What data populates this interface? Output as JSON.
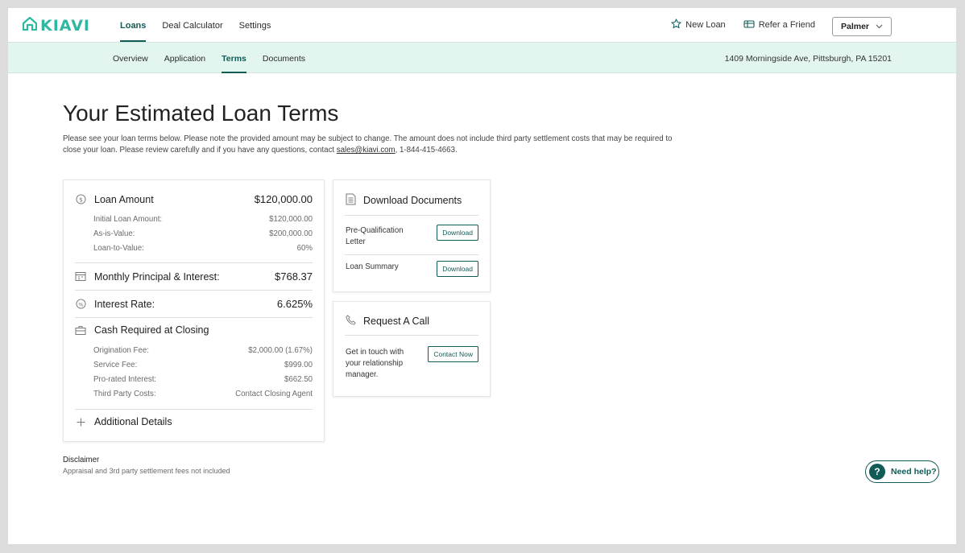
{
  "brand": {
    "name": "KIAVI",
    "color": "#2fb8a0",
    "accent": "#115b56"
  },
  "topnav": {
    "links": [
      {
        "label": "Loans",
        "active": true
      },
      {
        "label": "Deal Calculator",
        "active": false
      },
      {
        "label": "Settings",
        "active": false
      }
    ],
    "new_loan": "New Loan",
    "refer": "Refer a Friend",
    "user": "Palmer"
  },
  "subnav": {
    "links": [
      {
        "label": "Overview"
      },
      {
        "label": "Application"
      },
      {
        "label": "Terms"
      },
      {
        "label": "Documents"
      }
    ],
    "address": "1409 Morningside Ave, Pittsburgh, PA 15201"
  },
  "page": {
    "title": "Your Estimated Loan Terms",
    "intro_before": "Please see your loan terms below. Please note the provided amount may be subject to change. The amount does not include third party settlement costs that may be required to close your loan. Please review carefully and if you have any questions, contact ",
    "intro_email": "sales@kiavi.com",
    "intro_after": ", 1-844-415-4663."
  },
  "loan": {
    "amount_label": "Loan Amount",
    "amount_value": "$120,000.00",
    "amount_details": [
      {
        "label": "Initial Loan Amount:",
        "value": "$120,000.00"
      },
      {
        "label": "As-is-Value:",
        "value": "$200,000.00"
      },
      {
        "label": "Loan-to-Value:",
        "value": "60%"
      }
    ],
    "pi_label": "Monthly Principal & Interest:",
    "pi_value": "$768.37",
    "rate_label": "Interest Rate:",
    "rate_value": "6.625%",
    "cash_label": "Cash Required at Closing",
    "cash_details": [
      {
        "label": "Origination Fee:",
        "value": "$2,000.00 (1.67%)"
      },
      {
        "label": "Service Fee:",
        "value": "$999.00"
      },
      {
        "label": "Pro-rated Interest:",
        "value": "$662.50"
      },
      {
        "label": "Third Party Costs:",
        "value": "Contact Closing Agent"
      }
    ],
    "additional_label": "Additional Details"
  },
  "documents": {
    "title": "Download Documents",
    "items": [
      {
        "label_line1": "Pre-Qualification",
        "label_line2": "Letter",
        "button": "Download"
      },
      {
        "label_line1": "Loan Summary",
        "label_line2": "",
        "button": "Download"
      }
    ]
  },
  "call": {
    "title": "Request A Call",
    "text_line1": "Get in touch with",
    "text_line2": "your relationship",
    "text_line3": "manager.",
    "button": "Contact Now"
  },
  "disclaimer": {
    "title": "Disclaimer",
    "text": "Appraisal and 3rd party settlement fees not included"
  },
  "help": {
    "label": "Need help?"
  }
}
